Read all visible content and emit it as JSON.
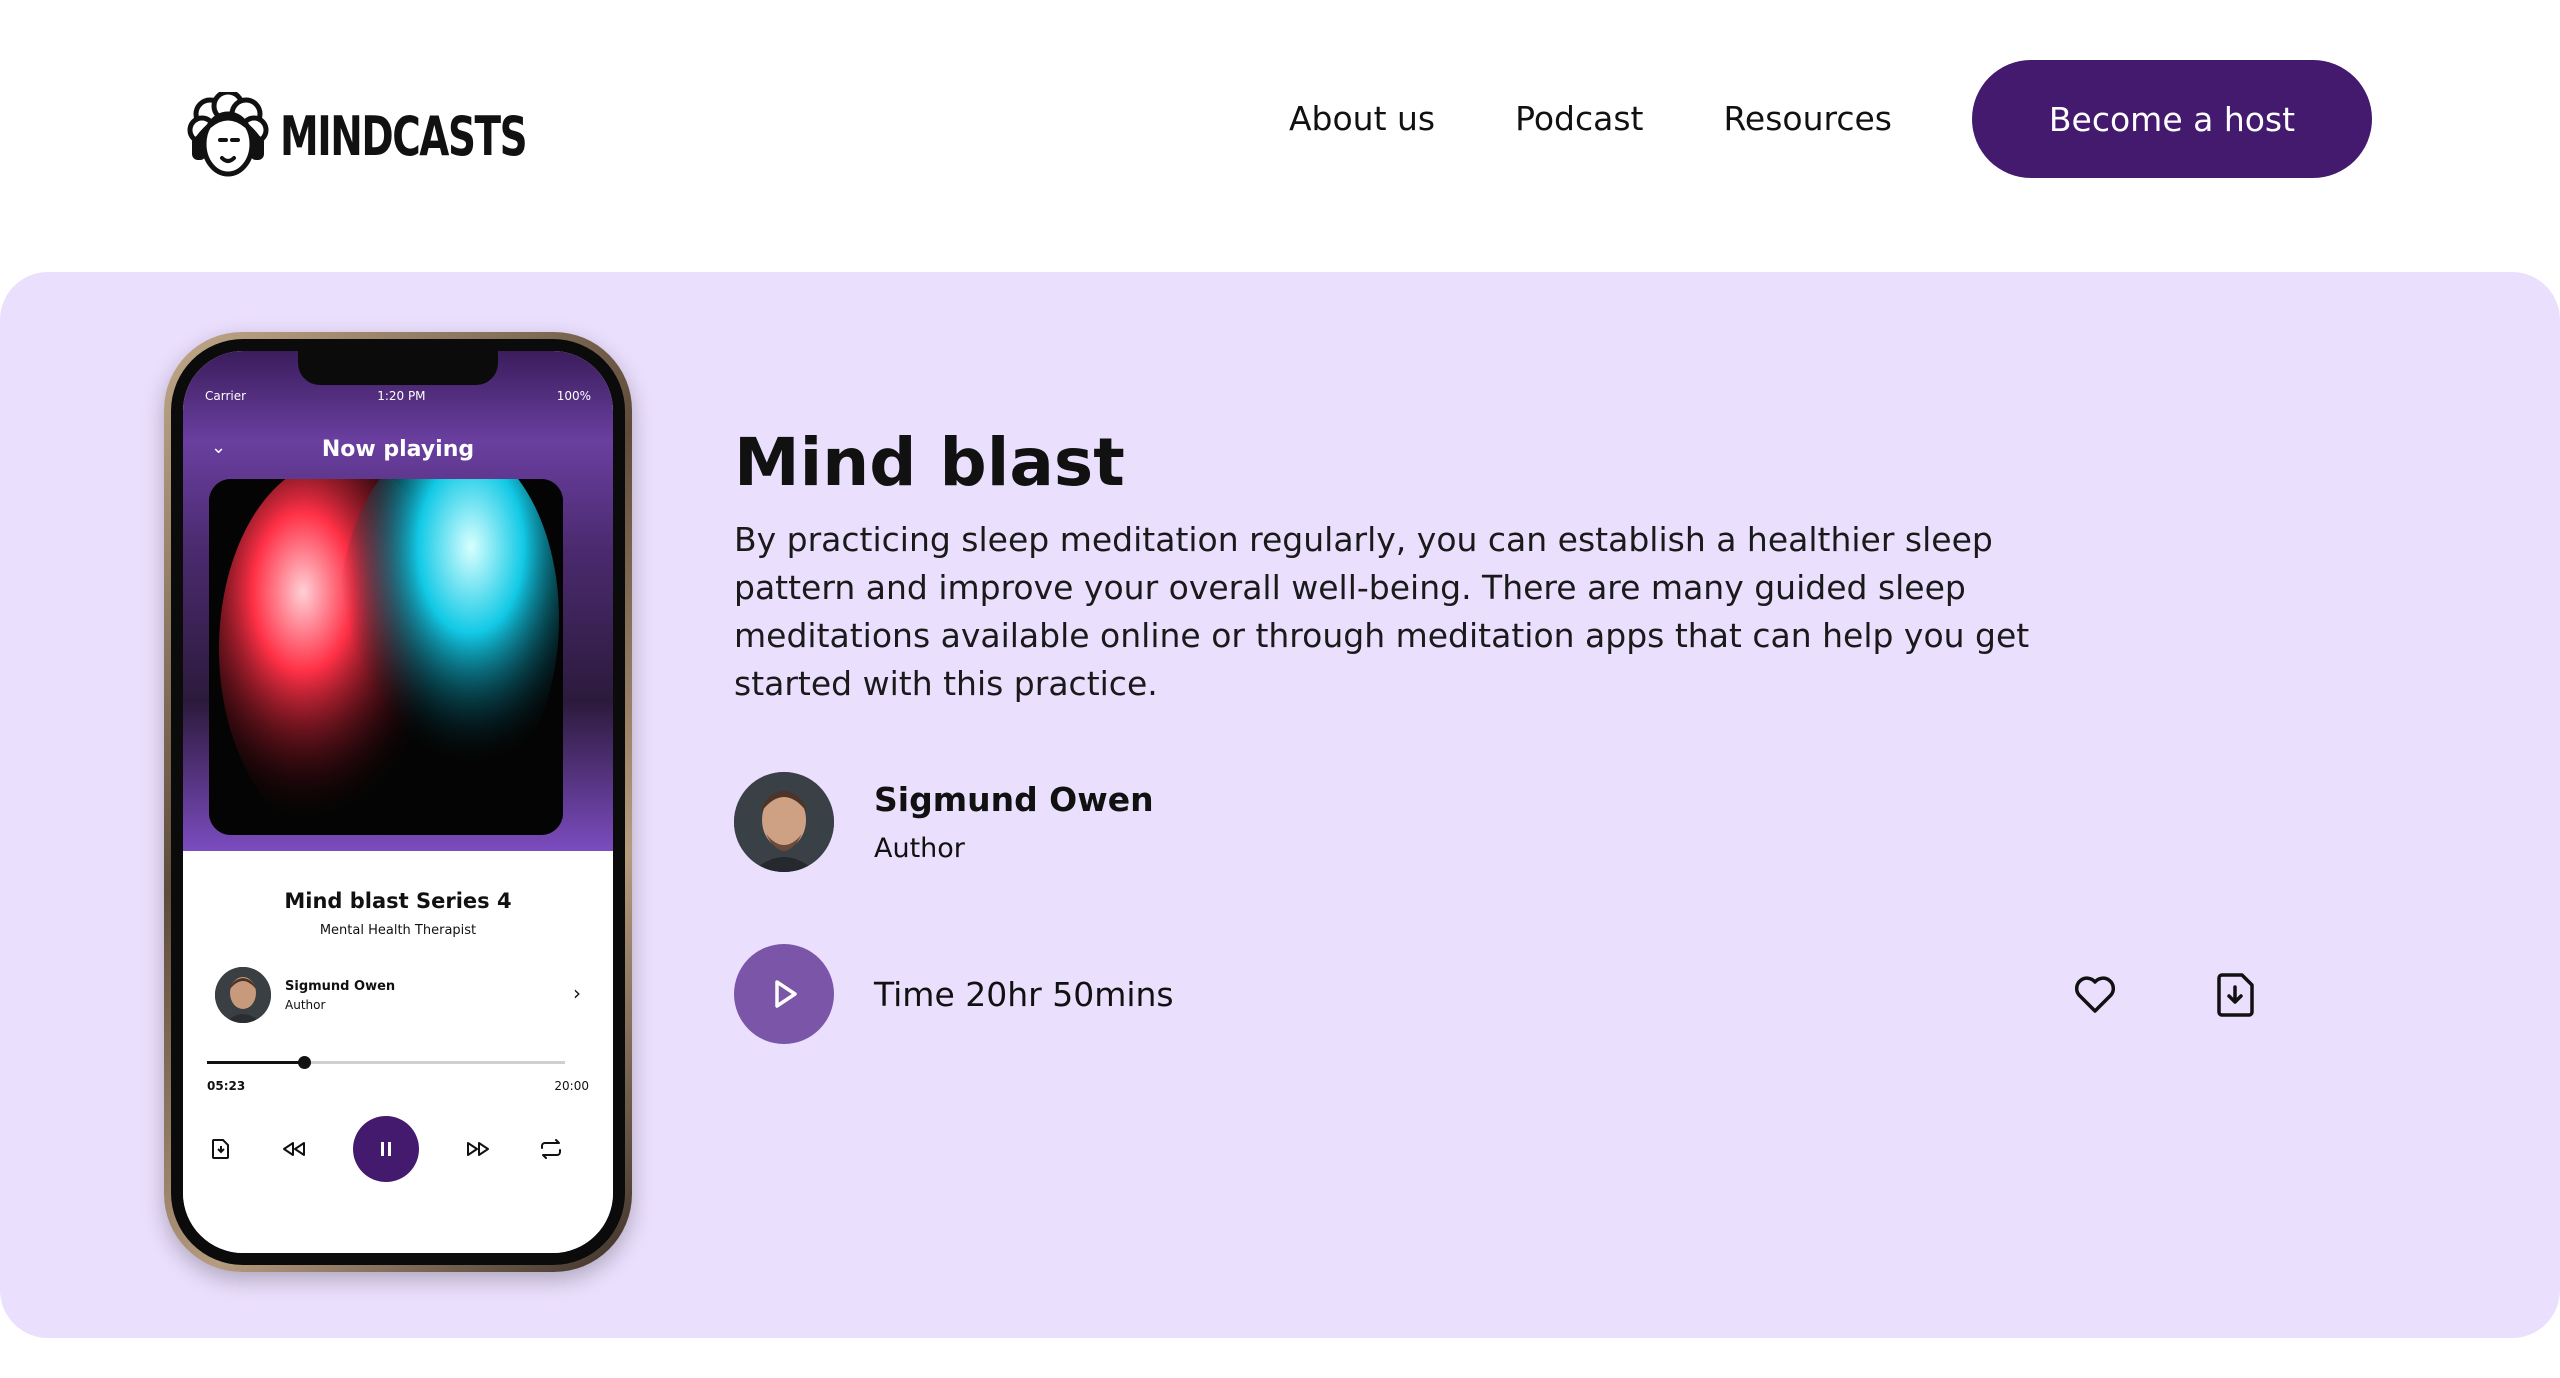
{
  "brand": {
    "name": "MINDCASTS"
  },
  "nav": {
    "links": [
      "About us",
      "Podcast",
      "Resources"
    ],
    "cta": "Become a host"
  },
  "phone": {
    "status": {
      "carrier": "Carrier",
      "time": "1:20 PM",
      "battery": "100%"
    },
    "header": "Now playing",
    "episode_title": "Mind blast Series 4",
    "episode_subtitle": "Mental Health Therapist",
    "author_name": "Sigmund Owen",
    "author_role": "Author",
    "elapsed": "05:23",
    "total": "20:00",
    "progress": 0.27
  },
  "podcast": {
    "title": "Mind blast",
    "description": "By practicing sleep meditation regularly, you can establish a healthier sleep pattern and improve your overall well-being. There are many guided sleep meditations available online or through meditation apps that can help you get started with this practice.",
    "author_name": "Sigmund Owen",
    "author_role": "Author",
    "duration": "Time 20hr 50mins"
  },
  "colors": {
    "primary": "#431a6e",
    "panel": "#eadffd",
    "play": "#7b55a8"
  },
  "icons": [
    "logo-sheep-icon",
    "play-icon",
    "heart-icon",
    "download-icon",
    "pause-icon",
    "rewind-icon",
    "fast-forward-icon",
    "repeat-icon",
    "chevron-down-icon",
    "chevron-right-icon"
  ]
}
